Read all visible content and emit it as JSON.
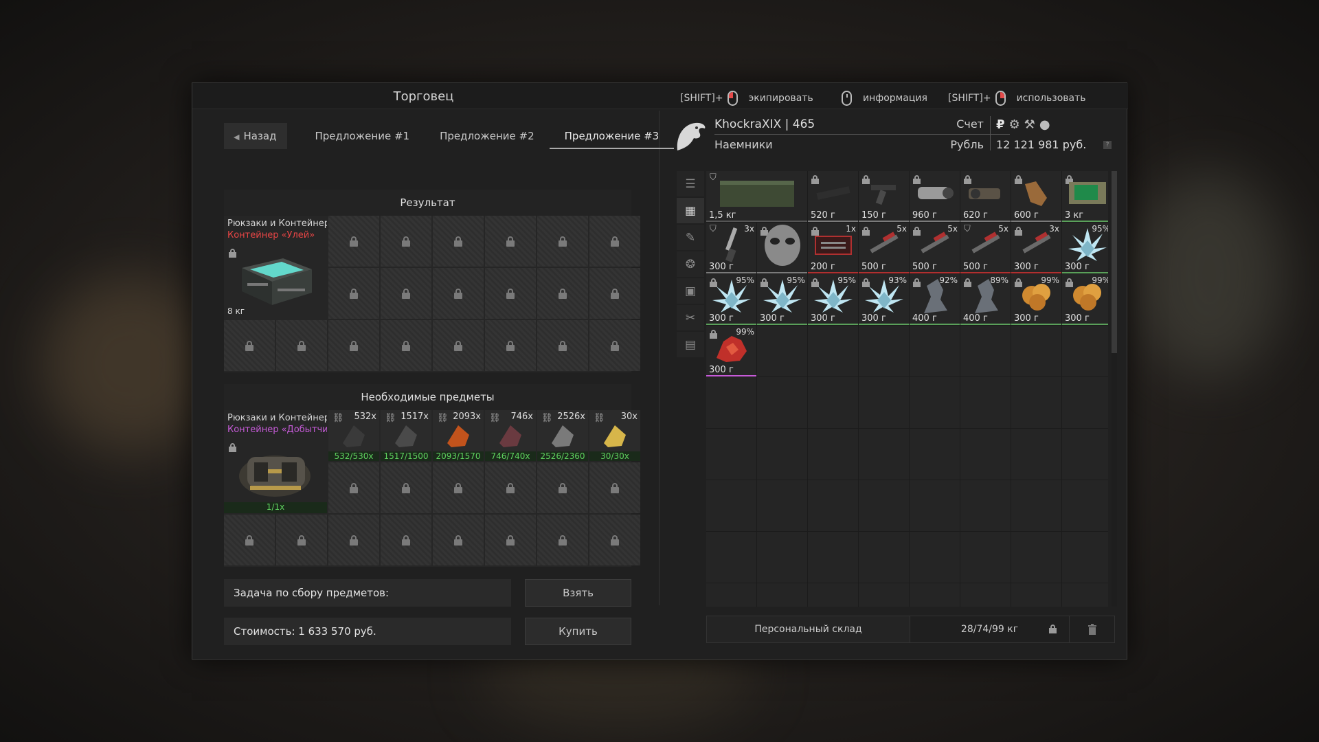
{
  "window": {
    "title": "Торговец"
  },
  "hints": [
    {
      "prefix": "[SHIFT]+",
      "mouse": "left-mouse-button",
      "label": "экипировать"
    },
    {
      "prefix": "",
      "mouse": "middle-mouse-button",
      "label": "информация"
    },
    {
      "prefix": "[SHIFT]+",
      "mouse": "right-mouse-button",
      "label": "использовать"
    }
  ],
  "tabs": {
    "back": "Назад",
    "offer1": "Предложение #1",
    "offer2": "Предложение #2",
    "offer3": "Предложение #3",
    "active": "offer3"
  },
  "result": {
    "heading": "Результат",
    "category": "Рюкзаки и Контейнеры",
    "name": "Контейнер «Улей»",
    "name_color": "#e84545",
    "weight": "8 кг"
  },
  "required": {
    "heading": "Необходимые предметы",
    "category": "Рюкзаки и Контейнеры",
    "name": "Контейнер «Добытчи...",
    "name_color": "#c65bd8",
    "count": "1/1x",
    "items": [
      {
        "count": "532x",
        "progress": "532/530x"
      },
      {
        "count": "1517x",
        "progress": "1517/1500"
      },
      {
        "count": "2093x",
        "progress": "2093/1570"
      },
      {
        "count": "746x",
        "progress": "746/740x"
      },
      {
        "count": "2526x",
        "progress": "2526/2360"
      },
      {
        "count": "30x",
        "progress": "30/30x"
      }
    ]
  },
  "task": {
    "label": "Задача по сбору предметов:",
    "button": "Взять"
  },
  "cost": {
    "label": "Стоимость: 1 633 570 руб.",
    "button": "Купить"
  },
  "player": {
    "name": "KhockraXIX | 465",
    "faction": "Наемники",
    "account_label": "Счет",
    "currency_label": "Рубль",
    "currency_symbol": "₽",
    "money": "12 121 981 руб.",
    "help": "?"
  },
  "inventory": [
    [
      {
        "w": "1,5 кг",
        "q": "",
        "bar": "#555555",
        "shape": "crate",
        "locktype": "shield"
      },
      {
        "w": "520 г",
        "q": "",
        "bar": "#7a7a7a",
        "shape": "tube",
        "locktype": "lock"
      },
      {
        "w": "150 г",
        "q": "",
        "bar": "#7a7a7a",
        "shape": "grip",
        "locktype": "lock"
      },
      {
        "w": "960 г",
        "q": "",
        "bar": "#7a7a7a",
        "shape": "scope",
        "locktype": "lock"
      },
      {
        "w": "620 г",
        "q": "",
        "bar": "#7a7a7a",
        "shape": "scope2",
        "locktype": "lock"
      },
      {
        "w": "600 г",
        "q": "",
        "bar": "#7a7a7a",
        "shape": "glove",
        "locktype": "lock"
      },
      {
        "w": "3 кг",
        "q": "",
        "bar": "#5aa05a",
        "shape": "device",
        "locktype": "lock"
      }
    ],
    [
      {
        "w": "300 г",
        "q": "3x",
        "bar": "#7a7a7a",
        "shape": "knife",
        "locktype": "shield"
      },
      {
        "w": "",
        "q": "",
        "bar": "#7a7a7a",
        "shape": "mask",
        "locktype": "lock"
      },
      {
        "w": "200 г",
        "q": "1x",
        "bar": "#b03030",
        "shape": "kit",
        "locktype": "lock"
      },
      {
        "w": "500 г",
        "q": "5x",
        "bar": "#b03030",
        "shape": "inj",
        "locktype": "lock"
      },
      {
        "w": "500 г",
        "q": "5x",
        "bar": "#b03030",
        "shape": "inj",
        "locktype": "lock"
      },
      {
        "w": "500 г",
        "q": "5x",
        "bar": "#b03030",
        "shape": "inj",
        "locktype": "shield"
      },
      {
        "w": "300 г",
        "q": "3x",
        "bar": "#b03030",
        "shape": "inj",
        "locktype": "lock"
      },
      {
        "w": "300 г",
        "q": "95%",
        "bar": "#5aa05a",
        "shape": "crystal",
        "locktype": "none"
      }
    ],
    [
      {
        "w": "300 г",
        "q": "95%",
        "bar": "#5aa05a",
        "shape": "crystal",
        "locktype": "lock"
      },
      {
        "w": "300 г",
        "q": "95%",
        "bar": "#5aa05a",
        "shape": "crystal",
        "locktype": "lock"
      },
      {
        "w": "300 г",
        "q": "95%",
        "bar": "#5aa05a",
        "shape": "crystal",
        "locktype": "lock"
      },
      {
        "w": "300 г",
        "q": "93%",
        "bar": "#5aa05a",
        "shape": "crystal",
        "locktype": "lock"
      },
      {
        "w": "400 г",
        "q": "92%",
        "bar": "#5aa05a",
        "shape": "rock",
        "locktype": "lock"
      },
      {
        "w": "400 г",
        "q": "89%",
        "bar": "#5aa05a",
        "shape": "rock",
        "locktype": "lock"
      },
      {
        "w": "300 г",
        "q": "99%",
        "bar": "#5aa05a",
        "shape": "orange",
        "locktype": "lock"
      },
      {
        "w": "300 г",
        "q": "99%",
        "bar": "#5aa05a",
        "shape": "orange",
        "locktype": "lock"
      }
    ],
    [
      {
        "w": "300 г",
        "q": "99%",
        "bar": "#c65bd8",
        "shape": "red",
        "locktype": "lock"
      }
    ]
  ],
  "storage": {
    "label": "Персональный склад",
    "weight": "28/74/99 кг"
  },
  "sidetabs": [
    "list-icon",
    "grid-icon",
    "weapon-icon",
    "armor-icon",
    "medkit-icon",
    "tools-icon",
    "box-icon"
  ]
}
